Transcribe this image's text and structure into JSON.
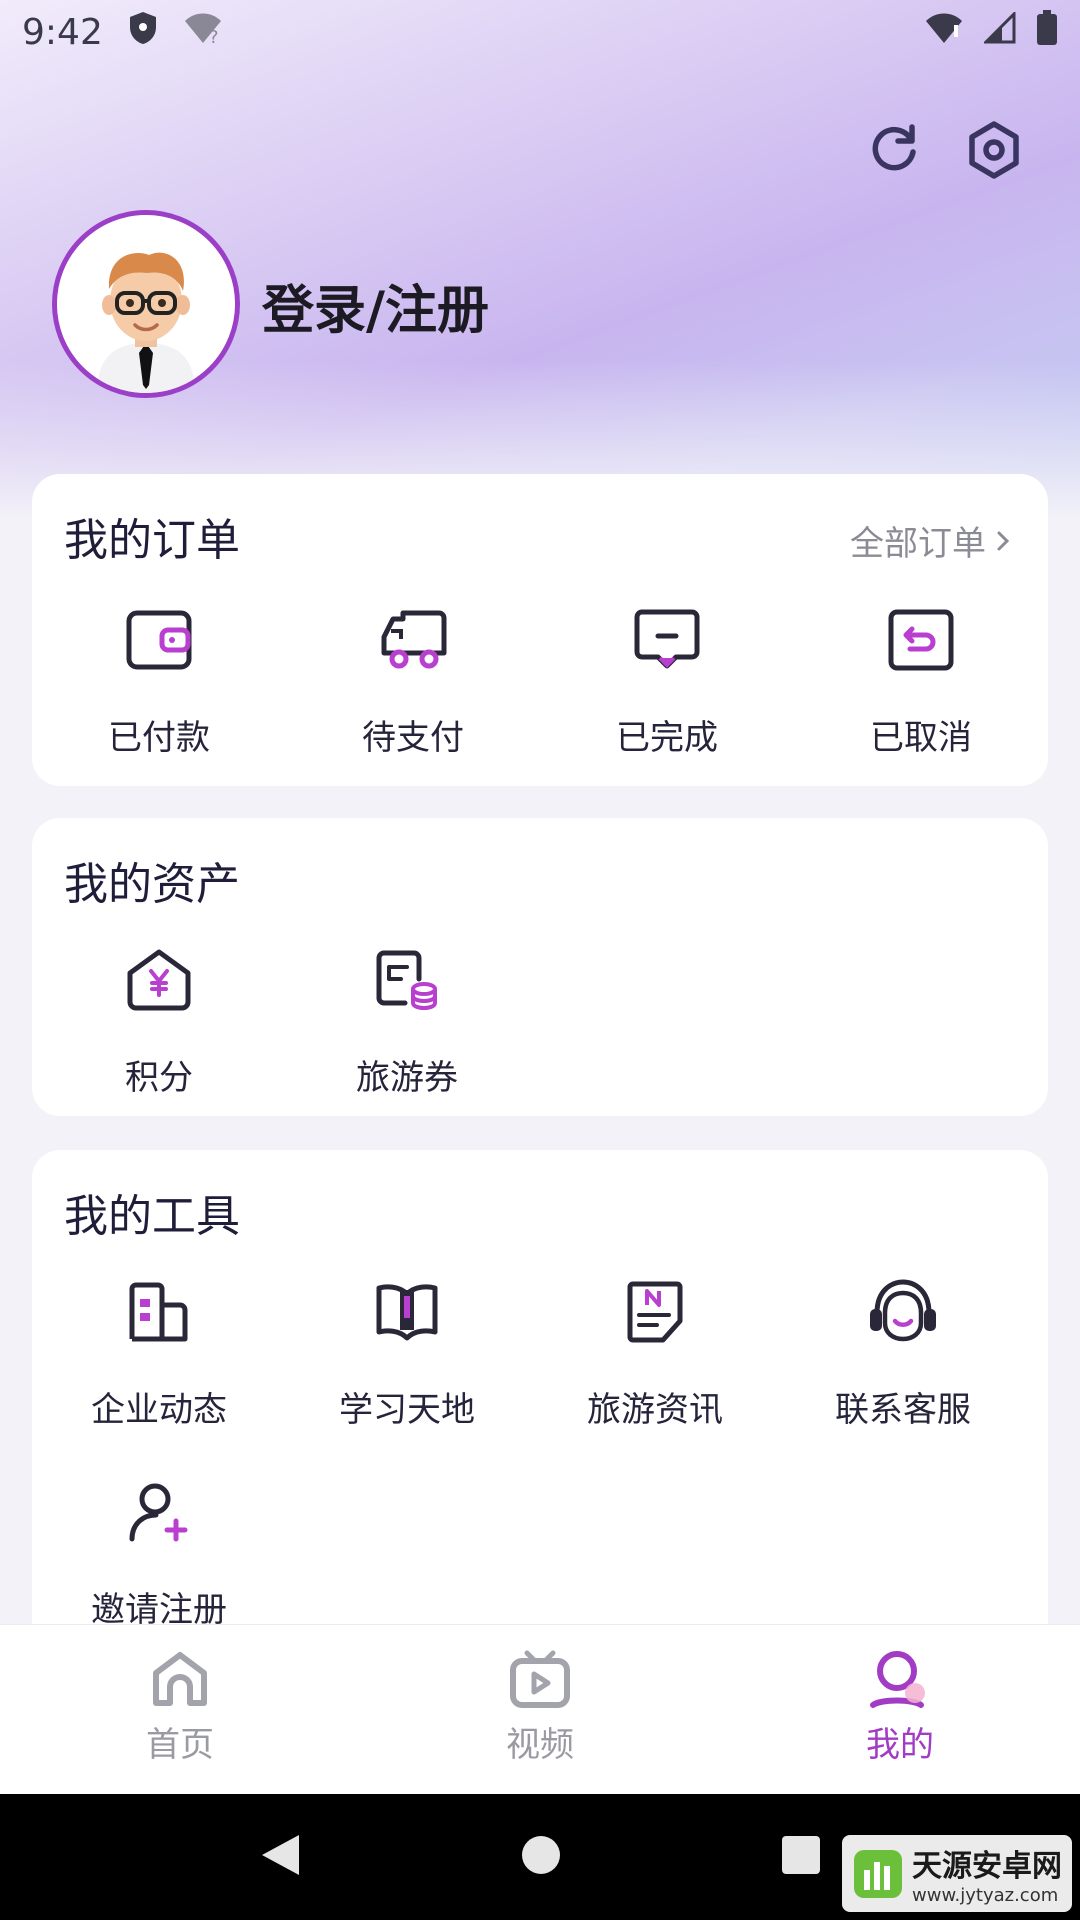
{
  "status_bar": {
    "time": "9:42"
  },
  "header": {
    "login_label": "登录/注册"
  },
  "orders": {
    "title": "我的订单",
    "all_link": "全部订单",
    "items": [
      {
        "label": "已付款",
        "icon": "wallet-icon"
      },
      {
        "label": "待支付",
        "icon": "delivery-truck-icon"
      },
      {
        "label": "已完成",
        "icon": "message-check-icon"
      },
      {
        "label": "已取消",
        "icon": "return-icon"
      }
    ]
  },
  "assets": {
    "title": "我的资产",
    "items": [
      {
        "label": "积分",
        "icon": "yuan-points-icon"
      },
      {
        "label": "旅游券",
        "icon": "coupon-icon"
      }
    ]
  },
  "tools": {
    "title": "我的工具",
    "items": [
      {
        "label": "企业动态",
        "icon": "building-icon"
      },
      {
        "label": "学习天地",
        "icon": "book-icon"
      },
      {
        "label": "旅游资讯",
        "icon": "news-icon"
      },
      {
        "label": "联系客服",
        "icon": "headset-icon"
      },
      {
        "label": "邀请注册",
        "icon": "add-user-icon"
      }
    ]
  },
  "bottom_nav": {
    "items": [
      {
        "label": "首页",
        "icon": "home-icon"
      },
      {
        "label": "视频",
        "icon": "tv-icon"
      },
      {
        "label": "我的",
        "icon": "profile-icon",
        "active": true
      }
    ]
  },
  "watermark": {
    "title": "天源安卓网",
    "url": "www.jytyaz.com"
  },
  "colors": {
    "accent": "#a23cc5",
    "icon_dark": "#2a2838",
    "text_muted": "#9a9aa2"
  }
}
